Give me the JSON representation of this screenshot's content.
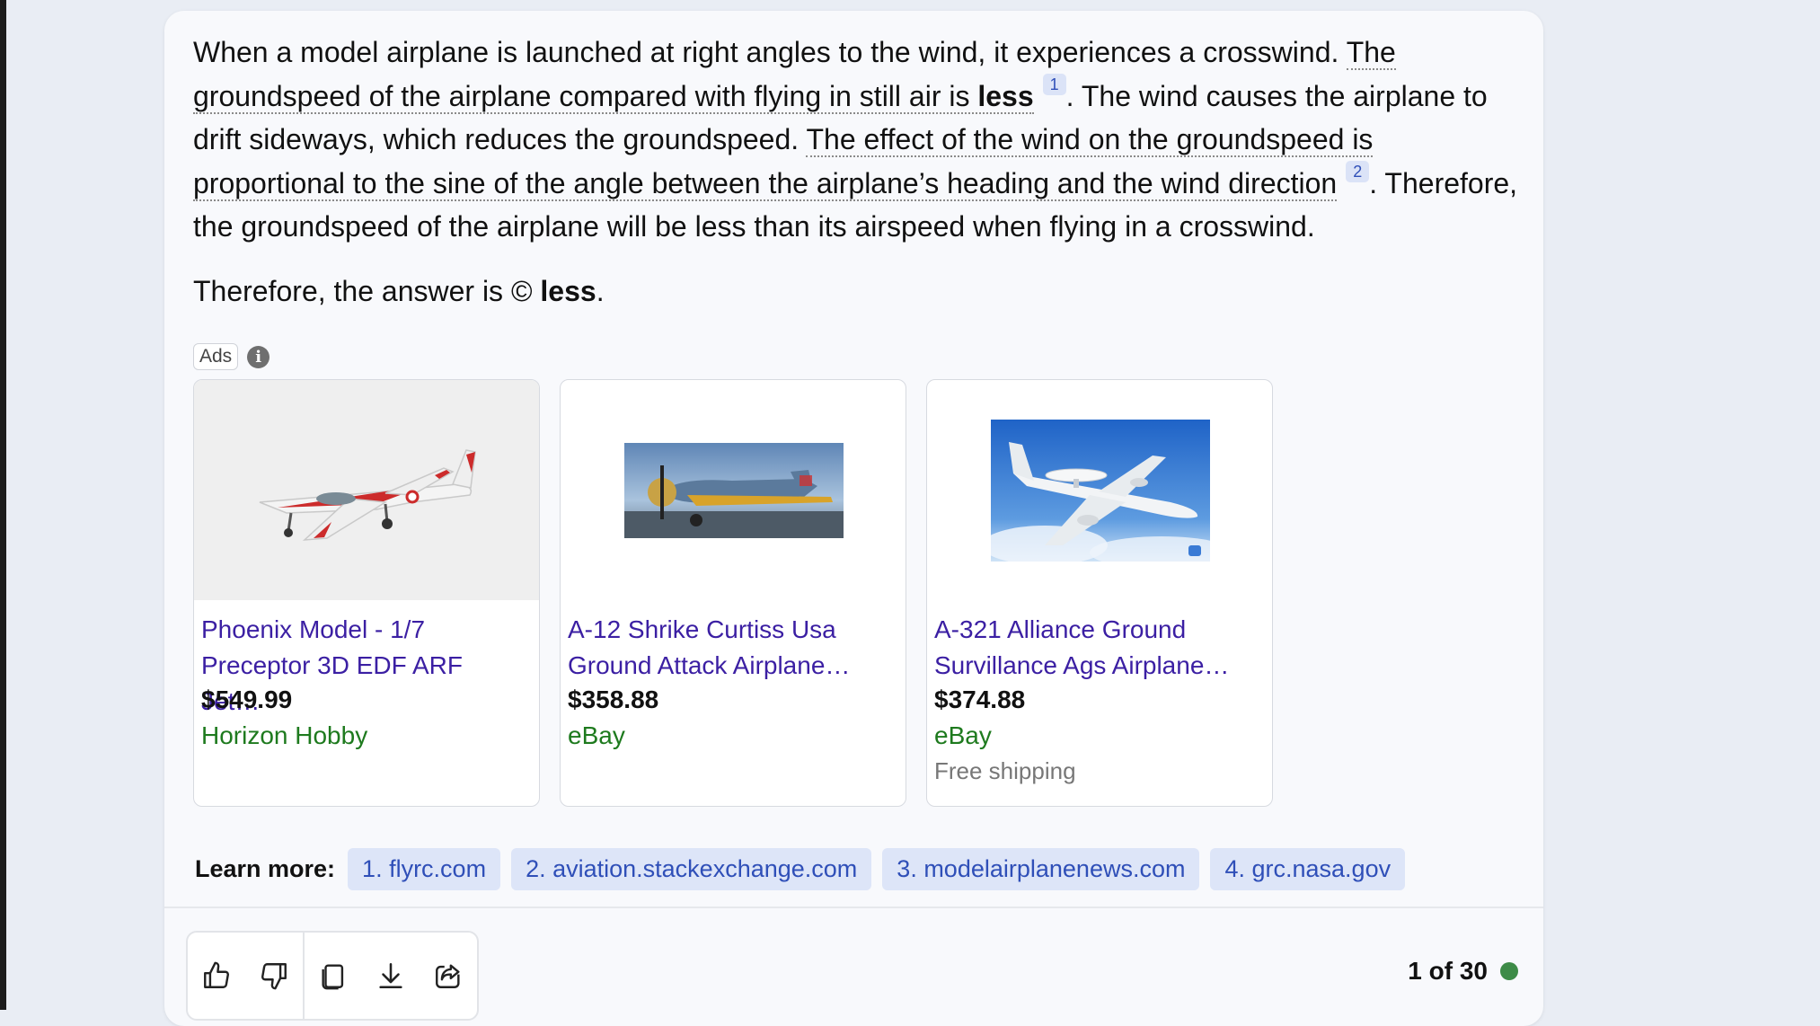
{
  "answer": {
    "p1_a": "When a model airplane is launched at right angles to the wind, it experiences a crosswind. ",
    "p1_cite1": "The groundspeed of the airplane compared with flying in still air is ",
    "p1_cite1_bold": "less",
    "p1_sup1": "1",
    "p1_b": ". The wind causes the airplane to drift sideways, which reduces the groundspeed. ",
    "p1_cite2": "The effect of the wind on the groundspeed is proportional to the sine of the angle between the airplane’s heading and the wind direction",
    "p1_sup2": "2",
    "p1_c": ". Therefore, the groundspeed of the airplane will be less than its airspeed when flying in a crosswind.",
    "p2_a": "Therefore, the answer is © ",
    "p2_bold": "less",
    "p2_end": "."
  },
  "ads": {
    "label": "Ads",
    "info_icon": "info-icon"
  },
  "products": [
    {
      "title": "Phoenix Model - 1/7 Preceptor 3D EDF ARF Jet…",
      "price": "$549.99",
      "seller": "Horizon Hobby",
      "shipping": ""
    },
    {
      "title": "A-12 Shrike Curtiss Usa Ground Attack Airplane…",
      "price": "$358.88",
      "seller": "eBay",
      "shipping": ""
    },
    {
      "title": "A-321 Alliance Ground Survillance Ags Airplane…",
      "price": "$374.88",
      "seller": "eBay",
      "shipping": "Free shipping"
    }
  ],
  "learn_more": {
    "label": "Learn more:",
    "links": [
      "1. flyrc.com",
      "2. aviation.stackexchange.com",
      "3. modelairplanenews.com",
      "4. grc.nasa.gov"
    ]
  },
  "toolbar": {
    "icons": [
      "thumbs-up-icon",
      "thumbs-down-icon",
      "copy-icon",
      "download-icon",
      "share-icon"
    ]
  },
  "counter": {
    "text": "1 of 30",
    "status_color": "#3d8b47"
  },
  "colors": {
    "link": "#3b1fa3",
    "seller": "#1e7a1e",
    "chip_bg": "#dde5f8",
    "chip_text": "#2f4fb8"
  }
}
